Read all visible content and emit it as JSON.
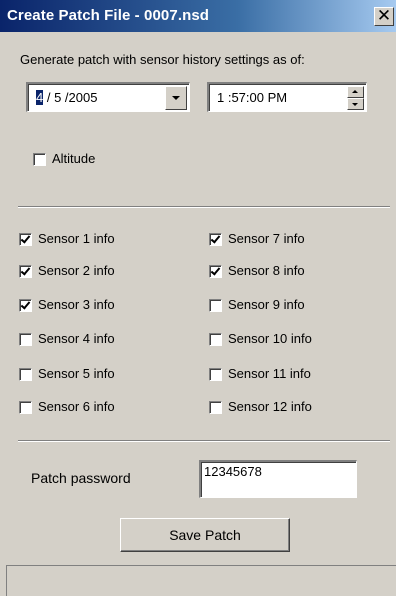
{
  "window": {
    "title": "Create Patch File - 0007.nsd",
    "close_glyph": "✕"
  },
  "form": {
    "heading": "Generate patch with sensor history settings as of:",
    "date": {
      "selected_part": "4",
      "rest": " / 5 /2005"
    },
    "time": {
      "value": "1 :57:00 PM"
    },
    "altitude": {
      "label": "Altitude",
      "checked": false
    }
  },
  "sensors": [
    {
      "label": "Sensor 1 info",
      "checked": true
    },
    {
      "label": "Sensor 2 info",
      "checked": true
    },
    {
      "label": "Sensor 3 info",
      "checked": true
    },
    {
      "label": "Sensor 4 info",
      "checked": false
    },
    {
      "label": "Sensor 5 info",
      "checked": false
    },
    {
      "label": "Sensor 6 info",
      "checked": false
    },
    {
      "label": "Sensor 7 info",
      "checked": true
    },
    {
      "label": "Sensor 8 info",
      "checked": true
    },
    {
      "label": "Sensor 9 info",
      "checked": false
    },
    {
      "label": "Sensor 10 info",
      "checked": false
    },
    {
      "label": "Sensor 11 info",
      "checked": false
    },
    {
      "label": "Sensor 12 info",
      "checked": false
    }
  ],
  "password": {
    "label": "Patch password",
    "value": "12345678"
  },
  "actions": {
    "save_label": "Save Patch"
  },
  "colors": {
    "titlebar_start": "#0a246a",
    "titlebar_end": "#a6caf0",
    "dialog_face": "#d4d0c8"
  }
}
